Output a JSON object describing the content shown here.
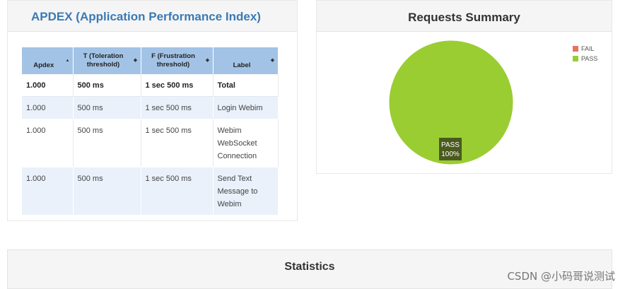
{
  "apdex": {
    "title": "APDEX (Application Performance Index)",
    "columns": [
      {
        "label": "Apdex",
        "sort": "▲"
      },
      {
        "label": "T (Toleration threshold)",
        "sort": "◆"
      },
      {
        "label": "F (Frustration threshold)",
        "sort": "◆"
      },
      {
        "label": "Label",
        "sort": "◆"
      }
    ],
    "rows": [
      {
        "apdex": "1.000",
        "t": "500 ms",
        "f": "1 sec 500 ms",
        "label": "Total"
      },
      {
        "apdex": "1.000",
        "t": "500 ms",
        "f": "1 sec 500 ms",
        "label": "Login Webim"
      },
      {
        "apdex": "1.000",
        "t": "500 ms",
        "f": "1 sec 500 ms",
        "label": "Webim WebSocket Connection"
      },
      {
        "apdex": "1.000",
        "t": "500 ms",
        "f": "1 sec 500 ms",
        "label": "Send Text Message to Webim"
      }
    ]
  },
  "requests_summary": {
    "title": "Requests Summary",
    "legend": [
      {
        "label": "FAIL",
        "color": "#e8735a"
      },
      {
        "label": "PASS",
        "color": "#9acd32"
      }
    ],
    "slice_label": "PASS",
    "slice_percent": "100%"
  },
  "chart_data": {
    "type": "pie",
    "categories": [
      "FAIL",
      "PASS"
    ],
    "values": [
      0,
      100
    ],
    "colors": [
      "#e8735a",
      "#9acd32"
    ],
    "title": "Requests Summary",
    "legend_position": "top-right"
  },
  "statistics": {
    "title": "Statistics"
  },
  "watermark": "CSDN @小码哥说测试"
}
